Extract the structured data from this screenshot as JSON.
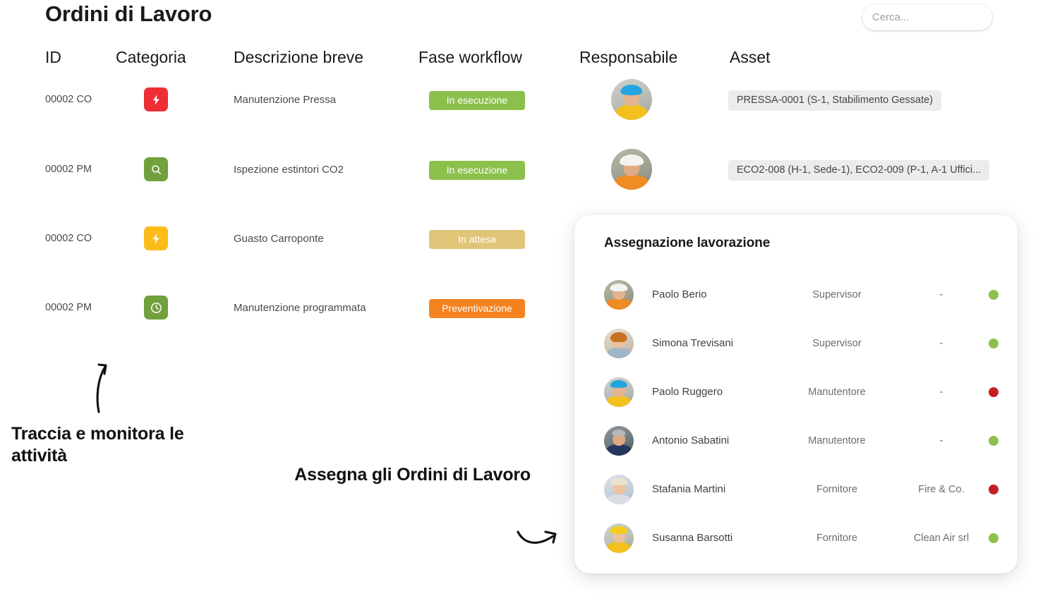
{
  "header": {
    "title": "Ordini di Lavoro"
  },
  "search": {
    "placeholder": "Cerca...",
    "value": "",
    "icon": "search-icon",
    "button_color": "#8cbf4b"
  },
  "table": {
    "columns": [
      "ID",
      "Categoria",
      "Descrizione breve",
      "Fase workflow",
      "Responsabile",
      "Asset"
    ],
    "rows": [
      {
        "id": "00002 CO",
        "category_icon": "bolt-icon",
        "category_color": "#ee2e35",
        "description": "Manutenzione Pressa",
        "phase": "In esecuzione",
        "phase_color": "#8cc04c",
        "responsible_avatar": "avatar-blue-helmet",
        "asset": "PRESSA-0001 (S-1, Stabilimento Gessate)"
      },
      {
        "id": "00002 PM",
        "category_icon": "magnifier-icon",
        "category_color": "#72a03c",
        "description": "Ispezione estintori CO2",
        "phase": "In esecuzione",
        "phase_color": "#8cc04c",
        "responsible_avatar": "avatar-white-helmet",
        "asset": "ECO2-008 (H-1, Sede-1), ECO2-009 (P-1, A-1 Uffici..."
      },
      {
        "id": "00002 CO",
        "category_icon": "bolt-icon",
        "category_color": "#fbbc1a",
        "description": "Guasto Carroponte",
        "phase": "In attesa",
        "phase_color": "#e0c579",
        "responsible_avatar": "",
        "asset": ""
      },
      {
        "id": "00002 PM",
        "category_icon": "clock-icon",
        "category_color": "#72a03c",
        "description": "Manutenzione programmata",
        "phase": "Preventivazione",
        "phase_color": "#f58220",
        "responsible_avatar": "",
        "asset": ""
      }
    ]
  },
  "assignment_panel": {
    "title": "Assegnazione lavorazione",
    "rows": [
      {
        "name": "Paolo Berio",
        "role": "Supervisor",
        "company": "-",
        "status_color": "#8cc04c",
        "avatar": "avatar-white-helmet"
      },
      {
        "name": "Simona Trevisani",
        "role": "Supervisor",
        "company": "-",
        "status_color": "#8cc04c",
        "avatar": "avatar-woman-red-hair"
      },
      {
        "name": "Paolo Ruggero",
        "role": "Manutentore",
        "company": "-",
        "status_color": "#c41f24",
        "avatar": "avatar-blue-helmet"
      },
      {
        "name": "Antonio Sabatini",
        "role": "Manutentore",
        "company": "-",
        "status_color": "#8cc04c",
        "avatar": "avatar-navy-shirt"
      },
      {
        "name": "Stafania Martini",
        "role": "Fornitore",
        "company": "Fire & Co.",
        "status_color": "#c41f24",
        "avatar": "avatar-blonde-woman"
      },
      {
        "name": "Susanna Barsotti",
        "role": "Fornitore",
        "company": "Clean Air srl",
        "status_color": "#8cc04c",
        "avatar": "avatar-yellow-helmet"
      }
    ]
  },
  "annotations": {
    "track": "Traccia e monitora le attività",
    "assign": "Assegna gli Ordini di Lavoro"
  }
}
